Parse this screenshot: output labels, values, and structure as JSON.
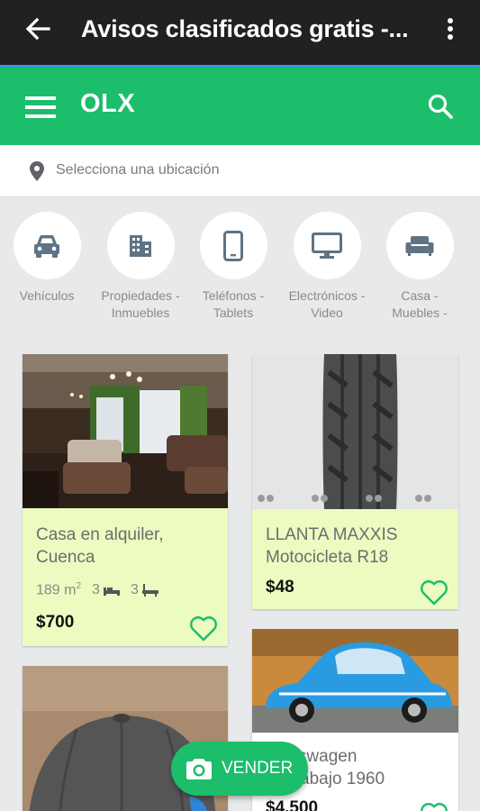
{
  "appbar": {
    "title": "Avisos clasificados gratis -..."
  },
  "header": {
    "brand": "OLX"
  },
  "location": {
    "placeholder": "Selecciona una ubicación"
  },
  "categories": [
    {
      "label1": "Vehículos",
      "label2": "",
      "icon": "car-icon"
    },
    {
      "label1": "Propiedades -",
      "label2": "Inmuebles",
      "icon": "building-icon"
    },
    {
      "label1": "Teléfonos -",
      "label2": "Tablets",
      "icon": "phone-icon"
    },
    {
      "label1": "Electrónicos -",
      "label2": "Video",
      "icon": "monitor-icon"
    },
    {
      "label1": "Casa -",
      "label2": "Muebles -",
      "icon": "sofa-icon"
    }
  ],
  "listings": [
    {
      "title1": "Casa en alquiler,",
      "title2": "Cuenca",
      "area": "189 m",
      "area_sup": "2",
      "beds": "3",
      "baths": "3",
      "price": "$700"
    },
    {
      "title1": "LLANTA MAXXIS",
      "title2": "Motocicleta R18",
      "price": "$48"
    },
    {
      "title1": "Volkswagen",
      "title2": "de trabajo 1960",
      "price": "$4.500"
    },
    {
      "title1": "",
      "title2": "",
      "price": ""
    }
  ],
  "fab": {
    "label": "VENDER",
    "icon": "camera-icon"
  },
  "colors": {
    "brand_green": "#1cbd6b",
    "card_bg": "#ecfbc0",
    "appbar": "#212121"
  }
}
